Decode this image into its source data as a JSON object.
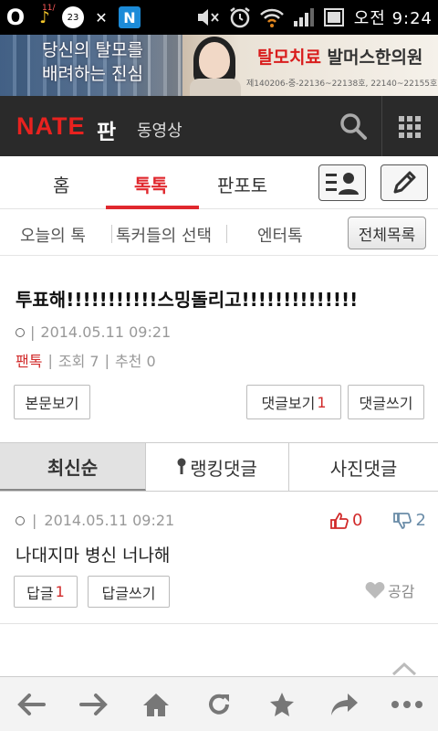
{
  "status_bar": {
    "o_icon": "O",
    "note_badge": "11/",
    "circle_badge": "23",
    "exo_icon": "✕",
    "n_icon": "N",
    "clock": "오전 9:24",
    "icons": [
      "mute-icon",
      "alarm-icon",
      "wifi-icon",
      "signal-icon",
      "battery-icon"
    ]
  },
  "ad": {
    "left_line1": "당신의 탈모를",
    "left_line2": "배려하는 진심",
    "right_red": "탈모치료",
    "right_black": " 발머스한의원",
    "address": "제140206-중-22136~22138호, 22140~22155호"
  },
  "header": {
    "logo": "NATE",
    "section": "판",
    "video": "동영상"
  },
  "tabs": {
    "items": [
      "홈",
      "톡톡",
      "판포토"
    ],
    "active": "톡톡"
  },
  "subnav": {
    "items": [
      "오늘의 톡",
      "톡커들의 선택",
      "엔터톡"
    ],
    "all_button": "전체목록"
  },
  "post": {
    "title": "투표해!!!!!!!!!!!스밍돌리고!!!!!!!!!!!!!!",
    "sep": "|",
    "datetime": "2014.05.11 09:21",
    "category": "팬톡",
    "views": "조회 7",
    "recommend": "추천 0",
    "view_body_button": "본문보기",
    "view_comments_button": "댓글보기",
    "comment_count": "1",
    "write_comment_button": "댓글쓰기"
  },
  "comment_tabs": {
    "items": [
      "최신순",
      "랭킹댓글",
      "사진댓글"
    ],
    "active": "최신순"
  },
  "comment": {
    "sep": "|",
    "datetime": "2014.05.11 09:21",
    "likes": "0",
    "dislikes": "2",
    "text": "나대지마 병신 너나해",
    "reply_button": "답글",
    "reply_count": "1",
    "write_reply_button": "답글쓰기",
    "empathy": "공감"
  },
  "toolbar": {
    "icons": [
      "back-arrow-icon",
      "forward-arrow-icon",
      "home-icon",
      "refresh-icon",
      "bookmark-star-icon",
      "share-icon",
      "more-icon"
    ]
  },
  "colors": {
    "accent_red": "#e0282e",
    "header_bg": "#2a2a2a"
  }
}
